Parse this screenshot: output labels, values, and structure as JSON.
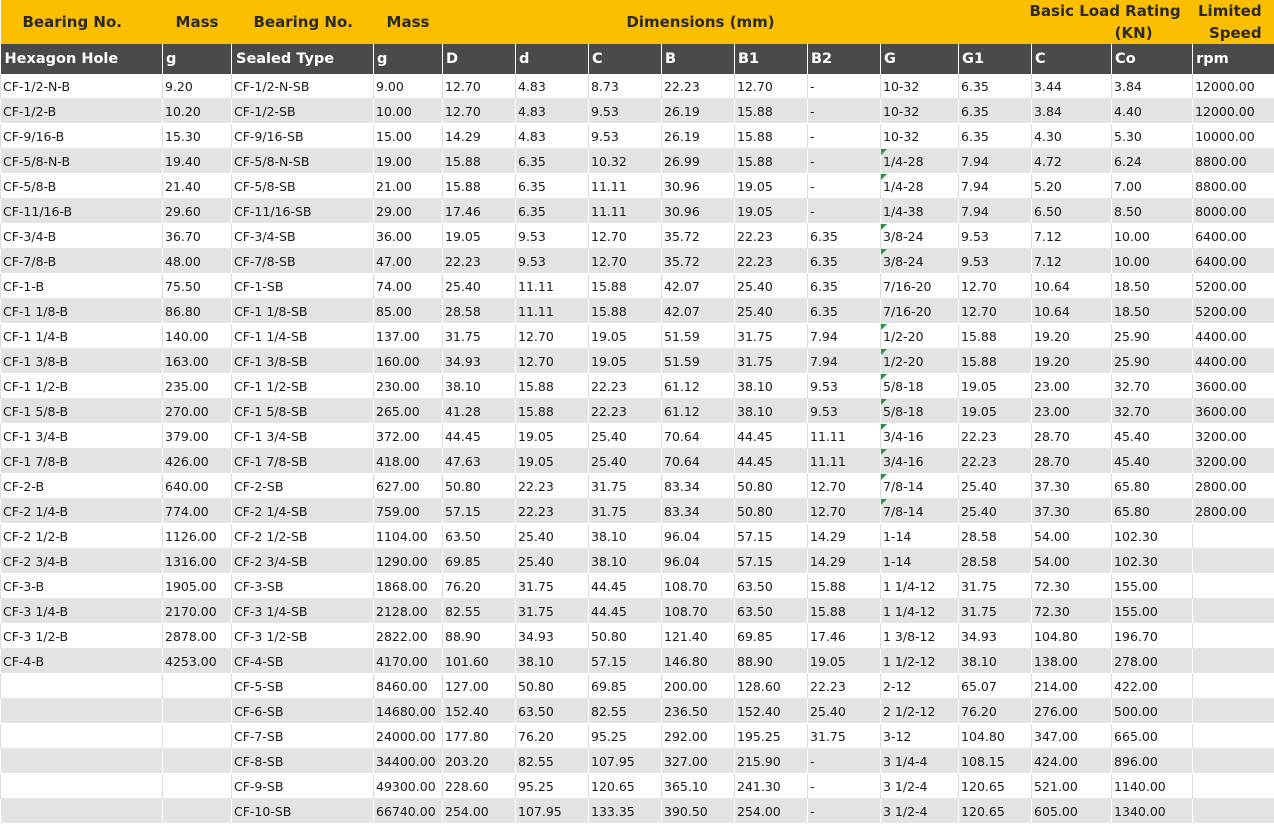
{
  "header_top": {
    "bearing_no": "Bearing No.",
    "mass": "Mass",
    "bearing_no_2": "Bearing No.",
    "mass_2": "Mass",
    "dimensions": "Dimensions (mm)",
    "basic_load_rating_line1": "Basic Load Rating",
    "basic_load_rating_line2": "(KN)",
    "limited_speed_line1": "Limited",
    "limited_speed_line2": "Speed"
  },
  "header_sub": [
    "Hexagon Hole",
    "g",
    "Sealed Type",
    "g",
    "D",
    "d",
    "C",
    "B",
    "B1",
    "B2",
    "G",
    "G1",
    "C",
    "Co",
    "rpm"
  ],
  "header_colors": {
    "top_band": "#fbbf00",
    "sub_band": "#494a4c",
    "row_alt": "#e3e3e3",
    "marker": "#1e9a3a"
  },
  "rows": [
    [
      "CF-1/2-N-B",
      "9.20",
      "CF-1/2-N-SB",
      "9.00",
      "12.70",
      "4.83",
      "8.73",
      "22.23",
      "12.70",
      "-",
      "10-32",
      "6.35",
      "3.44",
      "3.84",
      "12000.00"
    ],
    [
      "CF-1/2-B",
      "10.20",
      "CF-1/2-SB",
      "10.00",
      "12.70",
      "4.83",
      "9.53",
      "26.19",
      "15.88",
      "-",
      "10-32",
      "6.35",
      "3.84",
      "4.40",
      "12000.00"
    ],
    [
      "CF-9/16-B",
      "15.30",
      "CF-9/16-SB",
      "15.00",
      "14.29",
      "4.83",
      "9.53",
      "26.19",
      "15.88",
      "-",
      "10-32",
      "6.35",
      "4.30",
      "5.30",
      "10000.00"
    ],
    [
      "CF-5/8-N-B",
      "19.40",
      "CF-5/8-N-SB",
      "19.00",
      "15.88",
      "6.35",
      "10.32",
      "26.99",
      "15.88",
      "-",
      "1/4-28",
      "7.94",
      "4.72",
      "6.24",
      "8800.00"
    ],
    [
      "CF-5/8-B",
      "21.40",
      "CF-5/8-SB",
      "21.00",
      "15.88",
      "6.35",
      "11.11",
      "30.96",
      "19.05",
      "-",
      "1/4-28",
      "7.94",
      "5.20",
      "7.00",
      "8800.00"
    ],
    [
      "CF-11/16-B",
      "29.60",
      "CF-11/16-SB",
      "29.00",
      "17.46",
      "6.35",
      "11.11",
      "30.96",
      "19.05",
      "-",
      "1/4-38",
      "7.94",
      "6.50",
      "8.50",
      "8000.00"
    ],
    [
      "CF-3/4-B",
      "36.70",
      "CF-3/4-SB",
      "36.00",
      "19.05",
      "9.53",
      "12.70",
      "35.72",
      "22.23",
      "6.35",
      "3/8-24",
      "9.53",
      "7.12",
      "10.00",
      "6400.00"
    ],
    [
      "CF-7/8-B",
      "48.00",
      "CF-7/8-SB",
      "47.00",
      "22.23",
      "9.53",
      "12.70",
      "35.72",
      "22.23",
      "6.35",
      "3/8-24",
      "9.53",
      "7.12",
      "10.00",
      "6400.00"
    ],
    [
      "CF-1-B",
      "75.50",
      "CF-1-SB",
      "74.00",
      "25.40",
      "11.11",
      "15.88",
      "42.07",
      "25.40",
      "6.35",
      "7/16-20",
      "12.70",
      "10.64",
      "18.50",
      "5200.00"
    ],
    [
      "CF-1 1/8-B",
      "86.80",
      "CF-1 1/8-SB",
      "85.00",
      "28.58",
      "11.11",
      "15.88",
      "42.07",
      "25.40",
      "6.35",
      "7/16-20",
      "12.70",
      "10.64",
      "18.50",
      "5200.00"
    ],
    [
      "CF-1 1/4-B",
      "140.00",
      "CF-1 1/4-SB",
      "137.00",
      "31.75",
      "12.70",
      "19.05",
      "51.59",
      "31.75",
      "7.94",
      "1/2-20",
      "15.88",
      "19.20",
      "25.90",
      "4400.00"
    ],
    [
      "CF-1 3/8-B",
      "163.00",
      "CF-1 3/8-SB",
      "160.00",
      "34.93",
      "12.70",
      "19.05",
      "51.59",
      "31.75",
      "7.94",
      "1/2-20",
      "15.88",
      "19.20",
      "25.90",
      "4400.00"
    ],
    [
      "CF-1 1/2-B",
      "235.00",
      "CF-1 1/2-SB",
      "230.00",
      "38.10",
      "15.88",
      "22.23",
      "61.12",
      "38.10",
      "9.53",
      "5/8-18",
      "19.05",
      "23.00",
      "32.70",
      "3600.00"
    ],
    [
      "CF-1 5/8-B",
      "270.00",
      "CF-1 5/8-SB",
      "265.00",
      "41.28",
      "15.88",
      "22.23",
      "61.12",
      "38.10",
      "9.53",
      "5/8-18",
      "19.05",
      "23.00",
      "32.70",
      "3600.00"
    ],
    [
      "CF-1 3/4-B",
      "379.00",
      "CF-1 3/4-SB",
      "372.00",
      "44.45",
      "19.05",
      "25.40",
      "70.64",
      "44.45",
      "11.11",
      "3/4-16",
      "22.23",
      "28.70",
      "45.40",
      "3200.00"
    ],
    [
      "CF-1 7/8-B",
      "426.00",
      "CF-1 7/8-SB",
      "418.00",
      "47.63",
      "19.05",
      "25.40",
      "70.64",
      "44.45",
      "11.11",
      "3/4-16",
      "22.23",
      "28.70",
      "45.40",
      "3200.00"
    ],
    [
      "CF-2-B",
      "640.00",
      "CF-2-SB",
      "627.00",
      "50.80",
      "22.23",
      "31.75",
      "83.34",
      "50.80",
      "12.70",
      "7/8-14",
      "25.40",
      "37.30",
      "65.80",
      "2800.00"
    ],
    [
      "CF-2 1/4-B",
      "774.00",
      "CF-2 1/4-SB",
      "759.00",
      "57.15",
      "22.23",
      "31.75",
      "83.34",
      "50.80",
      "12.70",
      "7/8-14",
      "25.40",
      "37.30",
      "65.80",
      "2800.00"
    ],
    [
      "CF-2 1/2-B",
      "1126.00",
      "CF-2 1/2-SB",
      "1104.00",
      "63.50",
      "25.40",
      "38.10",
      "96.04",
      "57.15",
      "14.29",
      "1-14",
      "28.58",
      "54.00",
      "102.30",
      ""
    ],
    [
      "CF-2 3/4-B",
      "1316.00",
      "CF-2 3/4-SB",
      "1290.00",
      "69.85",
      "25.40",
      "38.10",
      "96.04",
      "57.15",
      "14.29",
      "1-14",
      "28.58",
      "54.00",
      "102.30",
      ""
    ],
    [
      "CF-3-B",
      "1905.00",
      "CF-3-SB",
      "1868.00",
      "76.20",
      "31.75",
      "44.45",
      "108.70",
      "63.50",
      "15.88",
      "1 1/4-12",
      "31.75",
      "72.30",
      "155.00",
      ""
    ],
    [
      "CF-3 1/4-B",
      "2170.00",
      "CF-3 1/4-SB",
      "2128.00",
      "82.55",
      "31.75",
      "44.45",
      "108.70",
      "63.50",
      "15.88",
      "1 1/4-12",
      "31.75",
      "72.30",
      "155.00",
      ""
    ],
    [
      "CF-3 1/2-B",
      "2878.00",
      "CF-3 1/2-SB",
      "2822.00",
      "88.90",
      "34.93",
      "50.80",
      "121.40",
      "69.85",
      "17.46",
      "1 3/8-12",
      "34.93",
      "104.80",
      "196.70",
      ""
    ],
    [
      "CF-4-B",
      "4253.00",
      "CF-4-SB",
      "4170.00",
      "101.60",
      "38.10",
      "57.15",
      "146.80",
      "88.90",
      "19.05",
      "1 1/2-12",
      "38.10",
      "138.00",
      "278.00",
      ""
    ],
    [
      "",
      "",
      "CF-5-SB",
      "8460.00",
      "127.00",
      "50.80",
      "69.85",
      "200.00",
      "128.60",
      "22.23",
      "2-12",
      "65.07",
      "214.00",
      "422.00",
      ""
    ],
    [
      "",
      "",
      "CF-6-SB",
      "14680.00",
      "152.40",
      "63.50",
      "82.55",
      "236.50",
      "152.40",
      "25.40",
      "2 1/2-12",
      "76.20",
      "276.00",
      "500.00",
      ""
    ],
    [
      "",
      "",
      "CF-7-SB",
      "24000.00",
      "177.80",
      "76.20",
      "95.25",
      "292.00",
      "195.25",
      "31.75",
      "3-12",
      "104.80",
      "347.00",
      "665.00",
      ""
    ],
    [
      "",
      "",
      "CF-8-SB",
      "34400.00",
      "203.20",
      "82.55",
      "107.95",
      "327.00",
      "215.90",
      "-",
      "3 1/4-4",
      "108.15",
      "424.00",
      "896.00",
      ""
    ],
    [
      "",
      "",
      "CF-9-SB",
      "49300.00",
      "228.60",
      "95.25",
      "120.65",
      "365.10",
      "241.30",
      "-",
      "3 1/2-4",
      "120.65",
      "521.00",
      "1140.00",
      ""
    ],
    [
      "",
      "",
      "CF-10-SB",
      "66740.00",
      "254.00",
      "107.95",
      "133.35",
      "390.50",
      "254.00",
      "-",
      "3 1/2-4",
      "120.65",
      "605.00",
      "1340.00",
      ""
    ]
  ],
  "g_marker_rows": [
    3,
    4,
    6,
    7,
    10,
    11,
    12,
    13,
    14,
    15,
    16,
    17
  ]
}
